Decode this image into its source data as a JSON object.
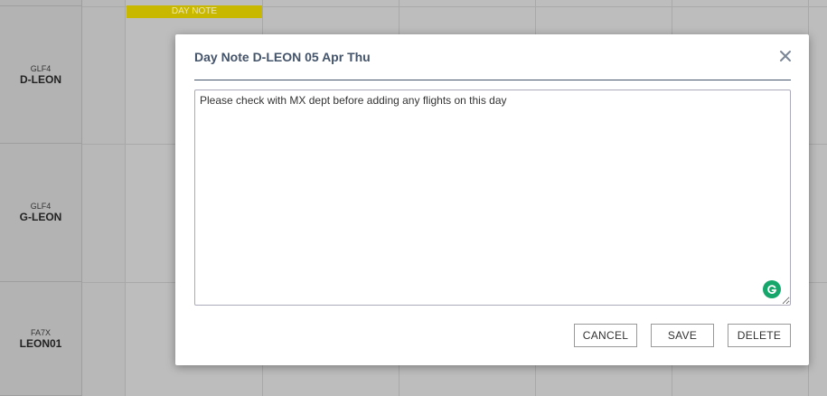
{
  "schedule": {
    "day_note_tag": "DAY NOTE",
    "rows": [
      {
        "type": "GLF4",
        "reg": "D-LEON"
      },
      {
        "type": "GLF4",
        "reg": "G-LEON"
      },
      {
        "type": "FA7X",
        "reg": "LEON01"
      }
    ]
  },
  "modal": {
    "title": "Day Note D-LEON 05 Apr Thu",
    "note_text": "Please check with MX dept before adding any flights on this day",
    "close_icon": "close-icon",
    "grammarly_icon": "grammarly-icon",
    "buttons": {
      "cancel": "CANCEL",
      "save": "SAVE",
      "delete": "DELETE"
    }
  }
}
